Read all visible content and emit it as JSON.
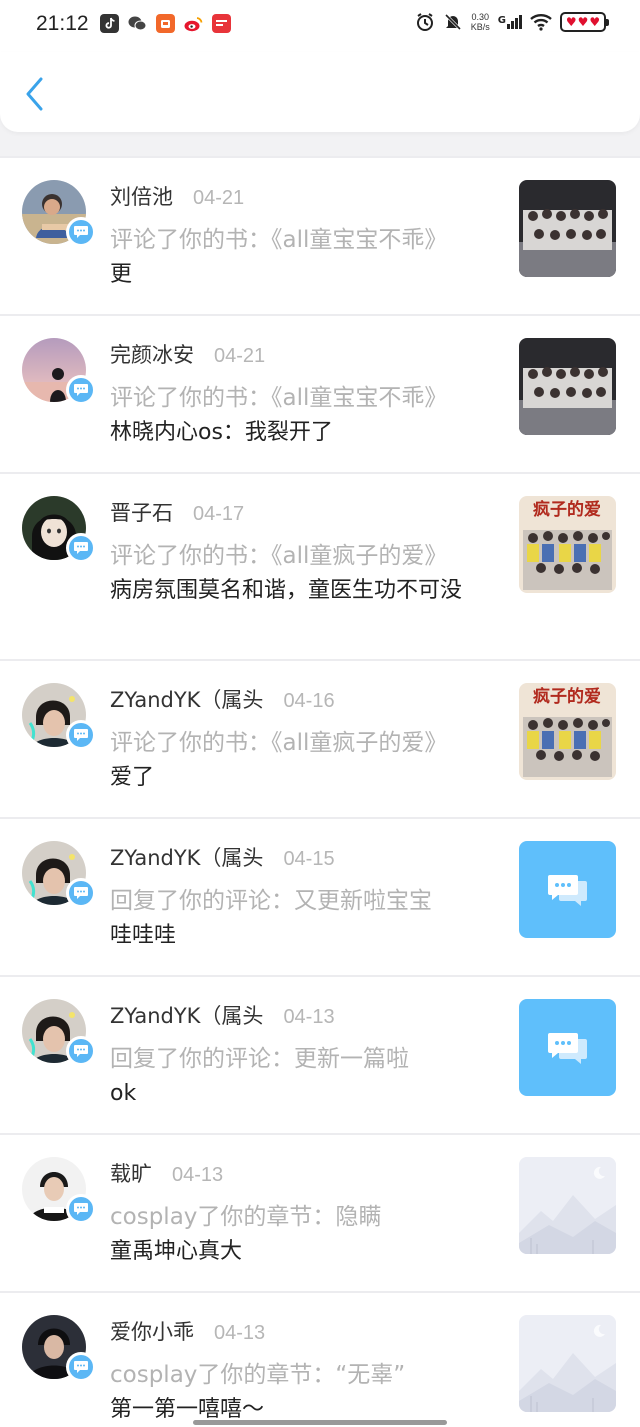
{
  "status_bar": {
    "time": "21:12",
    "net_speed_value": "0.30",
    "net_speed_unit": "KB/s",
    "signal_label": "G"
  },
  "header": {
    "back_icon": "chevron-left-icon"
  },
  "notifications": [
    {
      "name": "刘倍池",
      "date": "04-21",
      "action": "评论了你的书：《all童宝宝不乖》",
      "comment": "更",
      "thumb": "cover-photo"
    },
    {
      "name": "完颜冰安",
      "date": "04-21",
      "action": "评论了你的书：《all童宝宝不乖》",
      "comment": "林晓内心os：我裂开了",
      "thumb": "cover-photo"
    },
    {
      "name": "晋子石",
      "date": "04-17",
      "action": "评论了你的书：《all童疯子的爱》",
      "comment": "病房氛围莫名和谐，童医生功不可没",
      "thumb": "cover-crazy"
    },
    {
      "name": "ZYandYK（属头",
      "date": "04-16",
      "action": "评论了你的书：《all童疯子的爱》",
      "comment": "爱了",
      "thumb": "cover-crazy"
    },
    {
      "name": "ZYandYK（属头",
      "date": "04-15",
      "action": "回复了你的评论：又更新啦宝宝",
      "comment": "哇哇哇",
      "thumb": "message-icon"
    },
    {
      "name": "ZYandYK（属头",
      "date": "04-13",
      "action": "回复了你的评论：更新一篇啦",
      "comment": "ok",
      "thumb": "message-icon"
    },
    {
      "name": "载旷",
      "date": "04-13",
      "action": "cosplay了你的章节：隐瞒",
      "comment": "童禹坤心真大",
      "thumb": "placeholder"
    },
    {
      "name": "爱你小乖",
      "date": "04-13",
      "action": "cosplay了你的章节：“无辜”",
      "comment": "第一第一嘻嘻～",
      "thumb": "placeholder"
    }
  ],
  "cover_text": {
    "crazy_title": "疯子的爱"
  },
  "colors": {
    "accent": "#5bb7f5",
    "message_tile": "#5fbffb",
    "secondary_text": "#b3b3b3"
  }
}
